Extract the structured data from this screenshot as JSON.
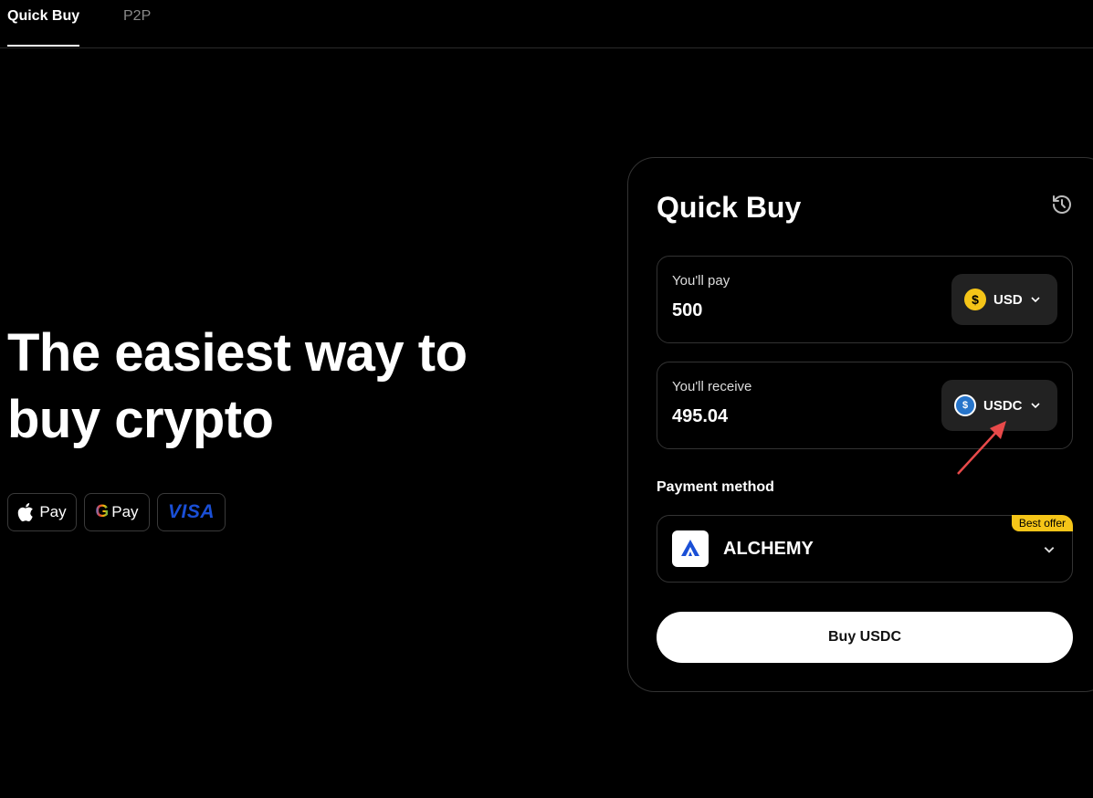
{
  "tabs": [
    {
      "label": "Quick Buy",
      "active": true
    },
    {
      "label": "P2P",
      "active": false
    }
  ],
  "hero": {
    "line1": "The easiest way to",
    "line2": "buy crypto"
  },
  "payment_badges": {
    "apple": {
      "icon": "apple-icon",
      "label": "Pay"
    },
    "google": {
      "icon": "google-g-icon",
      "g": "G",
      "label": "Pay"
    },
    "visa": {
      "label": "VISA"
    }
  },
  "quick_buy": {
    "title": "Quick Buy",
    "pay": {
      "label": "You'll pay",
      "amount": "500",
      "currency": "USD",
      "currency_icon": "usd-coin-icon"
    },
    "receive": {
      "label": "You'll receive",
      "amount": "495.04",
      "currency": "USDC",
      "currency_icon": "usdc-coin-icon"
    },
    "payment_method": {
      "label": "Payment method",
      "provider": "ALCHEMY",
      "badge": "Best offer"
    },
    "buy_button": "Buy USDC"
  },
  "colors": {
    "background": "#000000",
    "accent_yellow": "#f5c518",
    "usdc_blue": "#2775ca",
    "annotation_arrow": "#e84a4a"
  }
}
